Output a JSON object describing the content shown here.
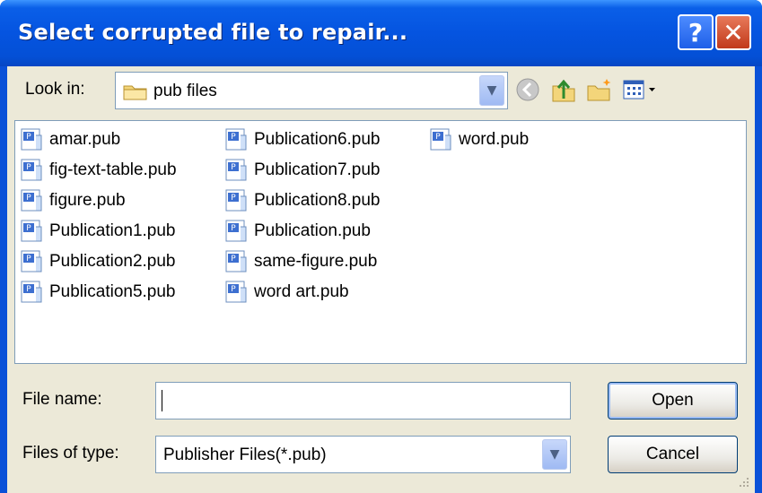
{
  "window": {
    "title": "Select corrupted file to repair..."
  },
  "titlebar_buttons": {
    "help_label": "?",
    "close_label": "✕"
  },
  "look_in": {
    "label": "Look in:",
    "value": "pub files"
  },
  "file_columns": [
    [
      "amar.pub",
      "fig-text-table.pub",
      "figure.pub",
      "Publication1.pub",
      "Publication2.pub",
      "Publication5.pub"
    ],
    [
      "Publication6.pub",
      "Publication7.pub",
      "Publication8.pub",
      "Publication.pub",
      "same-figure.pub",
      "word art.pub"
    ],
    [
      "word.pub"
    ]
  ],
  "file_name": {
    "label": "File name:",
    "value": ""
  },
  "file_type": {
    "label": "Files of type:",
    "value": "Publisher Files(*.pub)"
  },
  "buttons": {
    "open": "Open",
    "cancel": "Cancel"
  },
  "icons": {
    "folder": "folder-icon",
    "back": "back-icon",
    "up": "up-folder-icon",
    "new_folder": "new-folder-icon",
    "views": "views-menu-icon",
    "publisher_file": "publisher-file-icon"
  }
}
